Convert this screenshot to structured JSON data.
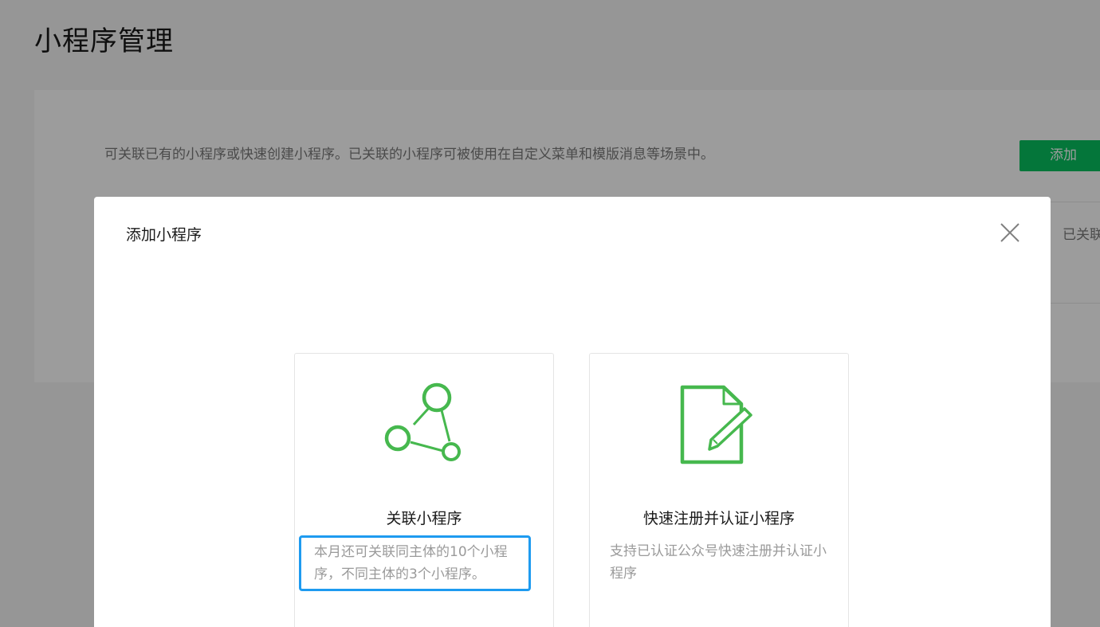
{
  "page": {
    "title": "小程序管理",
    "description": "可关联已有的小程序或快速创建小程序。已关联的小程序可被使用在自定义菜单和模版消息等场景中。",
    "add_button_label": "添加",
    "linked_header": "已关联"
  },
  "dialog": {
    "title": "添加小程序",
    "close_icon": "close-icon",
    "options": [
      {
        "icon": "network-nodes-icon",
        "title": "关联小程序",
        "description": "本月还可关联同主体的10个小程序，不同主体的3个小程序。"
      },
      {
        "icon": "document-edit-icon",
        "title": "快速注册并认证小程序",
        "description": "支持已认证公众号快速注册并认证小程序"
      }
    ]
  },
  "colors": {
    "accent_green": "#07c160",
    "icon_green": "#46b84e",
    "highlight_blue": "#1e9bf0"
  }
}
